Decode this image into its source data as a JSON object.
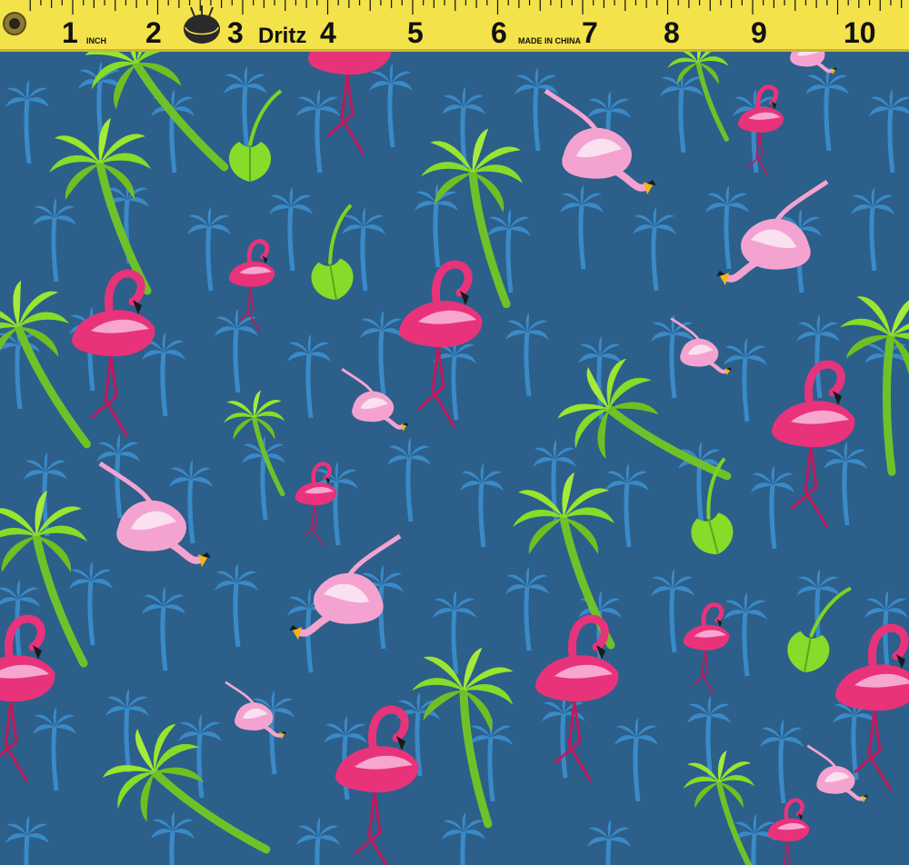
{
  "ruler": {
    "numbers": [
      "1",
      "2",
      "3",
      "4",
      "5",
      "6",
      "7",
      "8",
      "9",
      "10"
    ],
    "brand": "Dritz",
    "unit_label": "INCH",
    "origin_label": "MADE IN CHINA",
    "color": "#f3e24a"
  },
  "fabric": {
    "background_color": "#2c5f8a",
    "palm_silhouette_color": "#3d8fd0",
    "flamingo_hot_pink": "#e8337a",
    "flamingo_light_pink": "#f4a3d0",
    "palm_green": "#7ed321"
  }
}
